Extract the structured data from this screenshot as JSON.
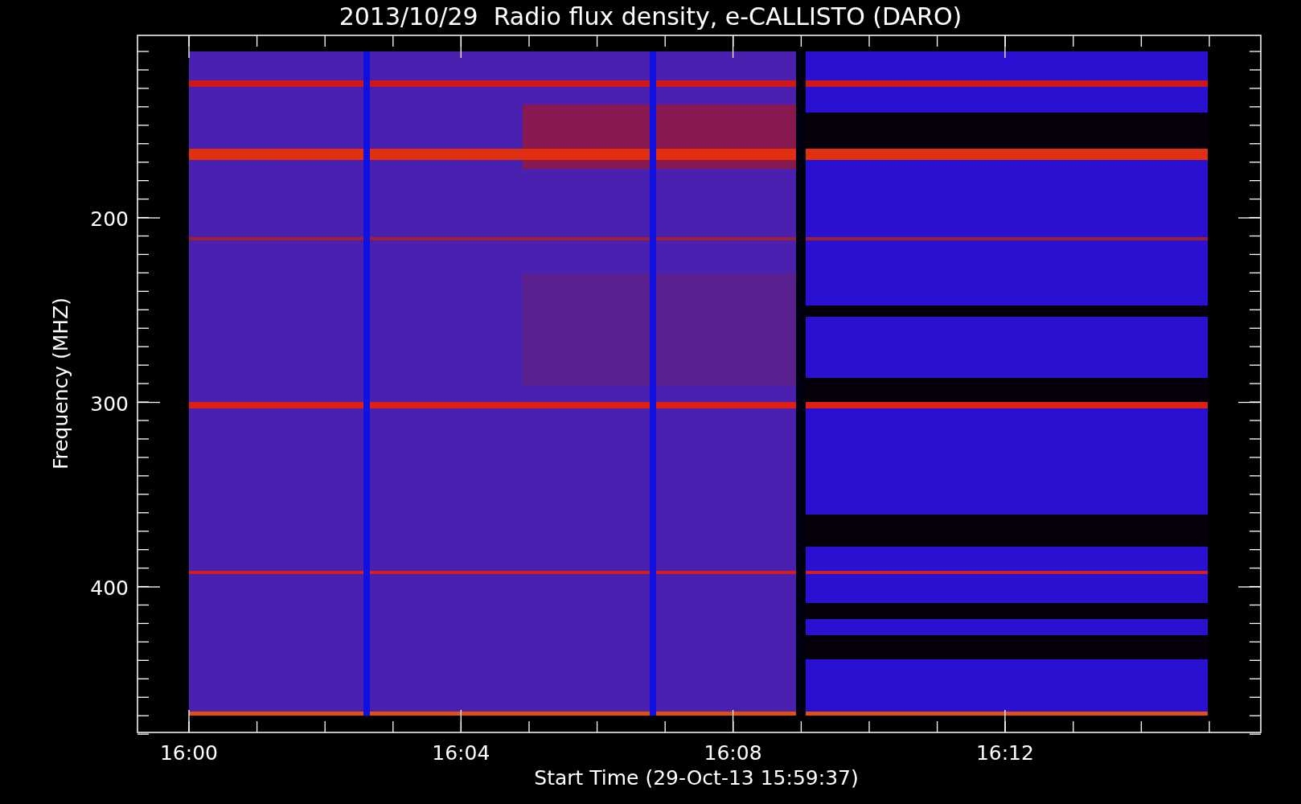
{
  "title": "2013/10/29  Radio flux density, e-CALLISTO (DARO)",
  "y_axis": {
    "label": "Frequency (MHZ)",
    "tick_labels": [
      "200",
      "300",
      "400"
    ]
  },
  "x_axis": {
    "label": "Start Time (29-Oct-13 15:59:37)",
    "tick_labels": [
      "16:00",
      "16:04",
      "16:08",
      "16:12"
    ]
  }
}
